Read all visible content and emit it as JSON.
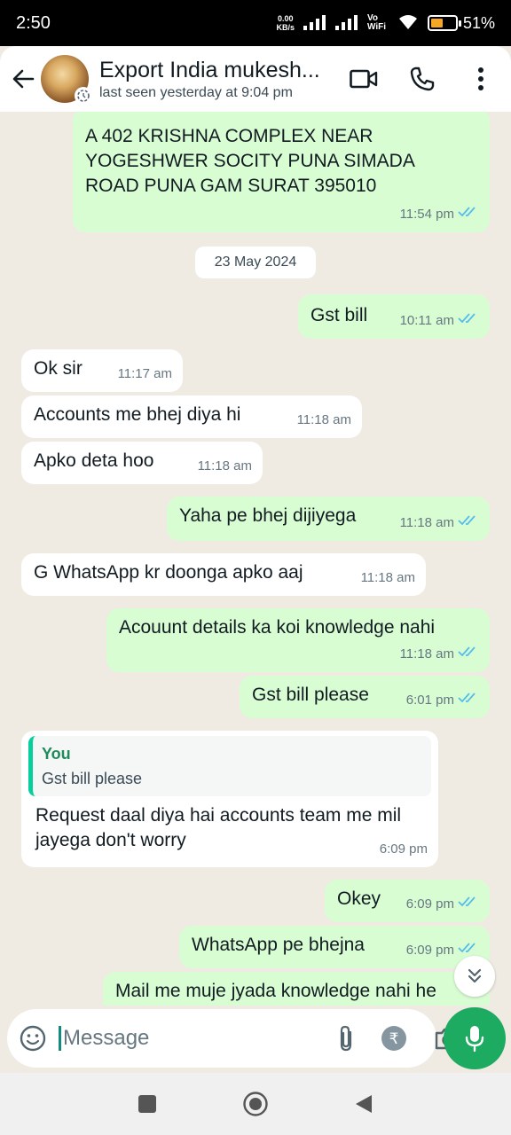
{
  "status_bar": {
    "time": "2:50",
    "net_speed_value": "0.00",
    "net_speed_unit": "KB/s",
    "vowifi": "Vo WiFi",
    "battery": "51%",
    "battery_level": 0.51
  },
  "header": {
    "contact_name": "Export India mukesh...",
    "last_seen": "last seen yesterday at 9:04 pm"
  },
  "date_chip": "23 May 2024",
  "messages": [
    {
      "dir": "out",
      "text": "A 402 KRISHNA COMPLEX NEAR YOGESHWER SOCITY PUNA SIMADA ROAD PUNA GAM SURAT 395010",
      "time": "11:54 pm"
    },
    {
      "dir": "out",
      "text": "Gst bill",
      "time": "10:11 am"
    },
    {
      "dir": "in",
      "text": "Ok sir",
      "time": "11:17 am"
    },
    {
      "dir": "in",
      "text": "Accounts me bhej diya hi",
      "time": "11:18 am"
    },
    {
      "dir": "in",
      "text": "Apko deta hoo",
      "time": "11:18 am"
    },
    {
      "dir": "out",
      "text": "Yaha pe bhej dijiyega",
      "time": "11:18 am"
    },
    {
      "dir": "in",
      "text": "G WhatsApp kr doonga apko aaj",
      "time": "11:18 am"
    },
    {
      "dir": "out",
      "text": "Acouunt details ka koi knowledge nahi",
      "time": "11:18 am"
    },
    {
      "dir": "out",
      "text": "Gst bill please",
      "time": "6:01 pm"
    },
    {
      "dir": "in",
      "quote_author": "You",
      "quote_text": "Gst bill please",
      "text": "Request daal diya hai accounts team me mil jayega don't worry",
      "time": "6:09 pm"
    },
    {
      "dir": "out",
      "text": "Okey",
      "time": "6:09 pm"
    },
    {
      "dir": "out",
      "text": "WhatsApp pe bhejna",
      "time": "6:09 pm"
    },
    {
      "dir": "out",
      "text": "Mail me muje jyada knowledge nahi he",
      "time": ""
    }
  ],
  "input": {
    "placeholder": "Message"
  },
  "colors": {
    "outgoing_bubble": "#d9fdd3",
    "incoming_bubble": "#ffffff",
    "read_tick": "#53bdeb",
    "mic_button": "#1daa61"
  }
}
